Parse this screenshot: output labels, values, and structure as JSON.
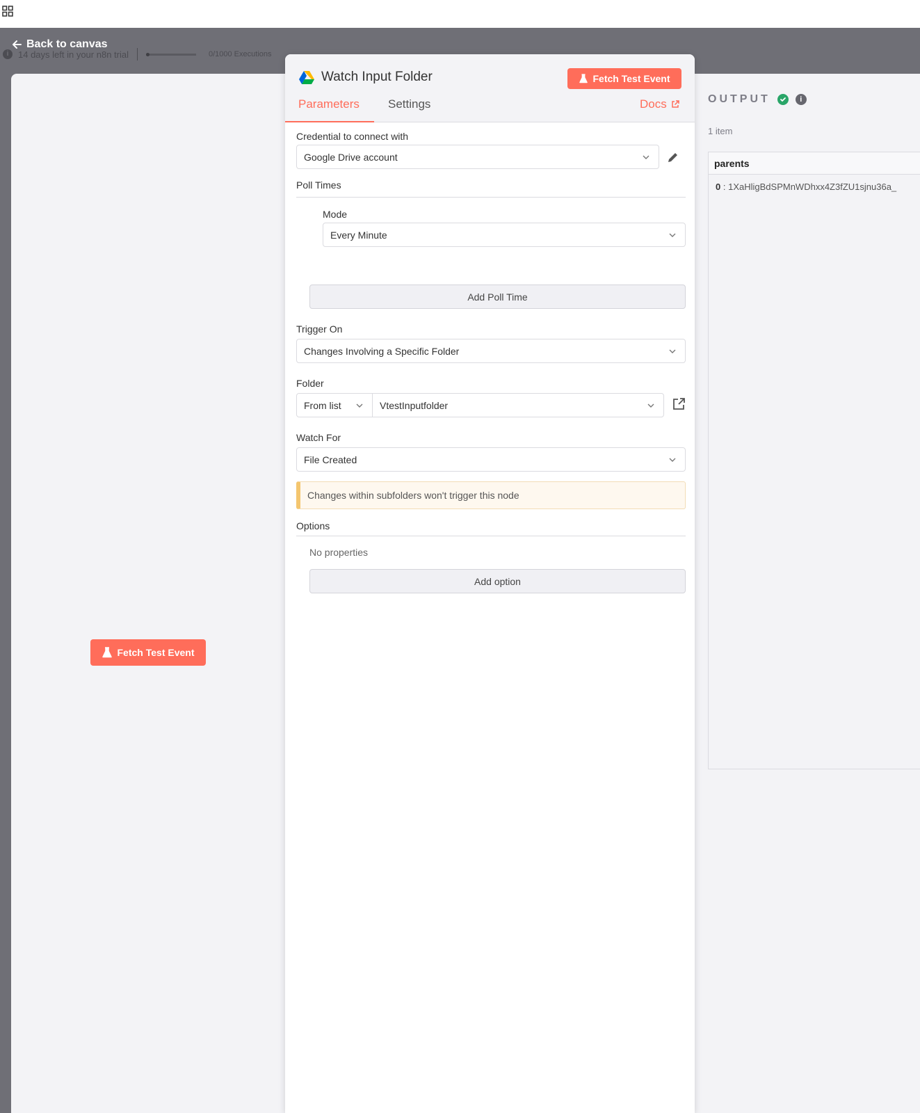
{
  "topbar": {
    "apps_icon": "grid-icon"
  },
  "background": {
    "back_label": "Back to canvas",
    "trial_text": "14 days left in your n8n trial",
    "executions_text": "0/1000 Executions",
    "left_fetch_label": "Fetch Test Event"
  },
  "node": {
    "icon": "google-drive-icon",
    "title": "Watch Input Folder",
    "fetch_label": "Fetch Test Event",
    "tabs": {
      "parameters": "Parameters",
      "settings": "Settings"
    },
    "docs_label": "Docs"
  },
  "form": {
    "credential_label": "Credential to connect with",
    "credential_value": "Google Drive account",
    "poll_times_label": "Poll Times",
    "mode_label": "Mode",
    "mode_value": "Every Minute",
    "add_poll_time_label": "Add Poll Time",
    "trigger_on_label": "Trigger On",
    "trigger_on_value": "Changes Involving a Specific Folder",
    "folder_label": "Folder",
    "folder_source_value": "From list",
    "folder_value": "VtestInputfolder",
    "watch_for_label": "Watch For",
    "watch_for_value": "File Created",
    "notice_text": "Changes within subfolders won't trigger this node",
    "options_label": "Options",
    "no_properties_text": "No properties",
    "add_option_label": "Add option"
  },
  "output": {
    "title": "OUTPUT",
    "item_count": "1 item",
    "column_header": "parents",
    "row_index": "0",
    "row_separator": ":",
    "row_value": "1XaHligBdSPMnWDhxx4Z3fZU1sjnu36a_"
  },
  "colors": {
    "accent": "#ff6d5a",
    "success": "#29a568",
    "notice_border": "#f4c66f"
  }
}
